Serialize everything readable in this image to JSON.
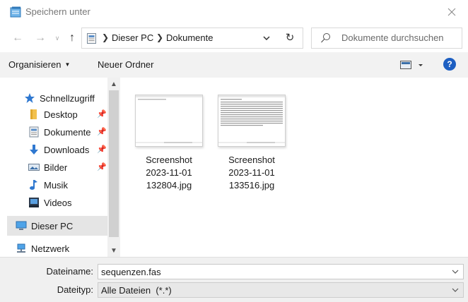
{
  "window": {
    "title": "Speichern unter"
  },
  "address": {
    "crumbs": [
      "Dieser PC",
      "Dokumente"
    ]
  },
  "search": {
    "placeholder": "Dokumente durchsuchen"
  },
  "toolbar": {
    "organize_label": "Organisieren",
    "new_folder_label": "Neuer Ordner"
  },
  "nav": {
    "quick_access": "Schnellzugriff",
    "items": [
      {
        "label": "Desktop",
        "icon": "folder-icon",
        "pinned": true
      },
      {
        "label": "Dokumente",
        "icon": "documents-icon",
        "pinned": true
      },
      {
        "label": "Downloads",
        "icon": "download-icon",
        "pinned": true
      },
      {
        "label": "Bilder",
        "icon": "pictures-icon",
        "pinned": true
      },
      {
        "label": "Musik",
        "icon": "music-icon",
        "pinned": false
      },
      {
        "label": "Videos",
        "icon": "video-icon",
        "pinned": false
      }
    ],
    "this_pc": "Dieser PC",
    "network": "Netzwerk"
  },
  "files": [
    {
      "name_line1": "Screenshot",
      "name_line2": "2023-11-01",
      "name_line3": "132804.jpg"
    },
    {
      "name_line1": "Screenshot",
      "name_line2": "2023-11-01",
      "name_line3": "133516.jpg"
    }
  ],
  "form": {
    "filename_label": "Dateiname:",
    "filename_value": "sequenzen.fas",
    "filetype_label": "Dateityp:",
    "filetype_value": "Alle Dateien  (*.*)"
  },
  "colors": {
    "accent": "#1d5fc2",
    "toolbar_bg": "#f2f2f2",
    "selection_bg": "#e5e5e5"
  }
}
